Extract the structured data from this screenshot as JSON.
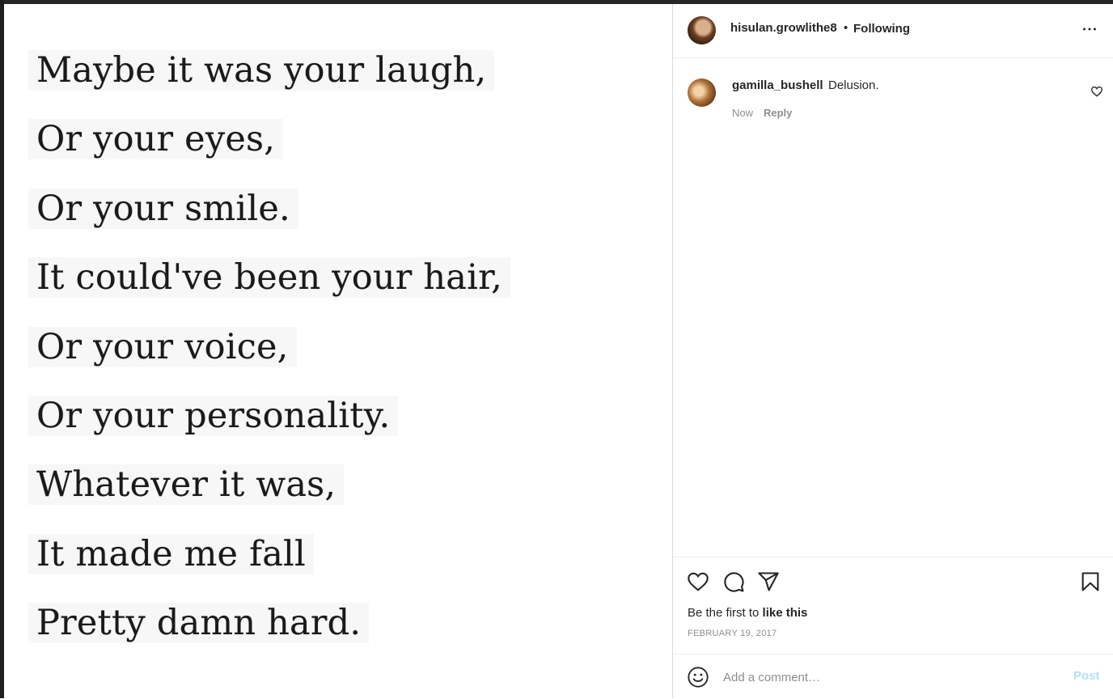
{
  "post": {
    "poem_lines": [
      "Maybe it was your laugh,",
      "Or your eyes,",
      "Or your smile.",
      "It could've been your hair,",
      "Or your voice,",
      "Or your personality.",
      "Whatever it was,",
      "It made me fall",
      "Pretty damn hard."
    ]
  },
  "header": {
    "username": "hisulan.growlithe8",
    "separator": "•",
    "follow_status": "Following",
    "more_icon": "more-horizontal-icon"
  },
  "comments": [
    {
      "username": "gamilla_bushell",
      "text": "Delusion.",
      "time": "Now",
      "reply_label": "Reply",
      "like_icon": "heart-outline-icon"
    }
  ],
  "actions": {
    "like_icon": "heart-outline-icon",
    "comment_icon": "speech-bubble-icon",
    "share_icon": "paper-plane-icon",
    "save_icon": "bookmark-icon"
  },
  "likes": {
    "prefix": "Be the first to ",
    "link": "like this"
  },
  "date": "FEBRUARY 19, 2017",
  "comment_box": {
    "placeholder": "Add a comment…",
    "post_label": "Post",
    "emoji_icon": "emoji-smile-icon"
  },
  "colors": {
    "text": "#262626",
    "muted": "#8e8e8e",
    "border": "#dbdbdb",
    "post_button_disabled": "#b2dffc"
  }
}
